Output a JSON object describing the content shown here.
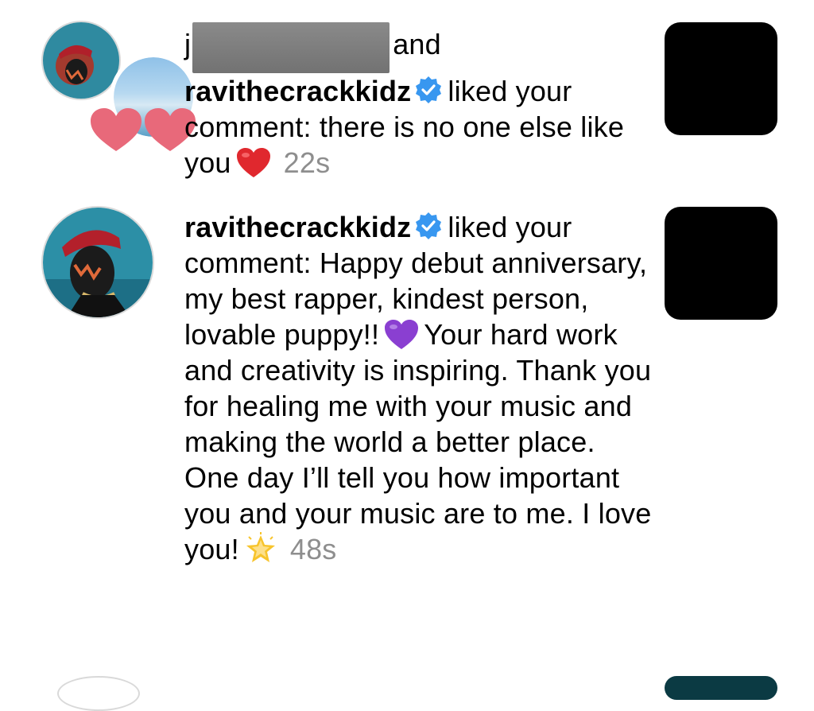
{
  "notifications": [
    {
      "user_prefix": "j",
      "joiner": "and",
      "username": "ravithecrackkidz",
      "action": "liked your comment:",
      "comment": "there is no one else like you",
      "emoji": "red-heart",
      "time": "22s",
      "avatar_icon": "stacked-avatars",
      "thumb_icon": "post-thumbnail"
    },
    {
      "username": "ravithecrackkidz",
      "action": "liked your comment:",
      "comment_part1": "Happy debut anniversary, my best rapper, kindest person, lovable puppy!!",
      "emoji_mid": "purple-heart",
      "comment_part2": "Your hard work and creativity is inspiring. Thank you for healing me with your music and making the world a better place. One day I’ll tell you how important you and your music are to me. I love you!",
      "emoji_end": "glowing-star",
      "time": "48s",
      "avatar_icon": "profile-avatar",
      "thumb_icon": "post-thumbnail"
    }
  ],
  "colors": {
    "verified_blue": "#3897f0",
    "timestamp_gray": "#8e8e8e",
    "red_heart": "#e0282e",
    "purple_heart": "#8a3fd1",
    "star_gold": "#f7c42c",
    "pink_heart": "#e8697a"
  }
}
